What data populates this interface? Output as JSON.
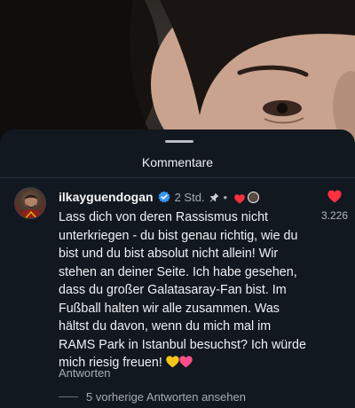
{
  "colors": {
    "sheet_bg": "#121820",
    "text_primary": "#eef1f4",
    "text_secondary": "#a7adb4",
    "verified_blue": "#3897f0",
    "like_red": "#ff3040"
  },
  "sheet": {
    "title": "Kommentare"
  },
  "comment": {
    "username": "ilkayguendogan",
    "verified_icon": "verified-badge-icon",
    "time": "2 Std.",
    "pinned_icon": "pin-icon",
    "separator": "•",
    "creator_liked_icon": "heart-icon",
    "text": "Lass dich von deren Rassismus nicht unterkriegen - du bist genau richtig, wie du bist und du bist absolut nicht allein! Wir stehen an deiner Seite. Ich habe gesehen, dass du großer Galatasaray-Fan bist. Im Fußball halten wir alle zusammen. Was hältst du davon, wenn du mich mal im RAMS Park in Istanbul besuchst? Ich würde mich riesig freuen!",
    "emojis": [
      "yellow-heart-emoji",
      "pink-heart-emoji"
    ],
    "reply_label": "Antworten",
    "like_count": "3.226",
    "view_replies_label": "5 vorherige Antworten ansehen"
  }
}
